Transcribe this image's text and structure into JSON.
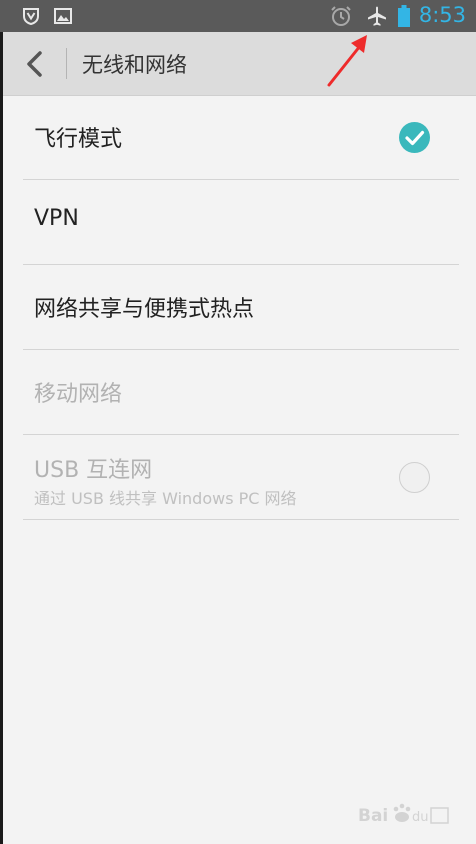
{
  "status_bar": {
    "time": "8:53",
    "time_color": "#33b5e5",
    "left_icons": [
      "shield-v-icon",
      "image-icon"
    ],
    "right_icons": [
      "alarm-icon",
      "airplane-icon",
      "battery-icon"
    ]
  },
  "header": {
    "title": "无线和网络"
  },
  "settings": {
    "airplane_mode": {
      "label": "飞行模式",
      "checked": true,
      "accent": "#3ab8bc"
    },
    "vpn": {
      "label": "VPN"
    },
    "tethering": {
      "label": "网络共享与便携式热点"
    },
    "mobile_network": {
      "label": "移动网络",
      "enabled": false
    },
    "usb_tethering": {
      "label": "USB 互连网",
      "summary": "通过 USB 线共享 Windows PC 网络",
      "enabled": false,
      "checked": false
    }
  },
  "annotation": {
    "type": "red-arrow",
    "color": "#ee2b2b"
  }
}
